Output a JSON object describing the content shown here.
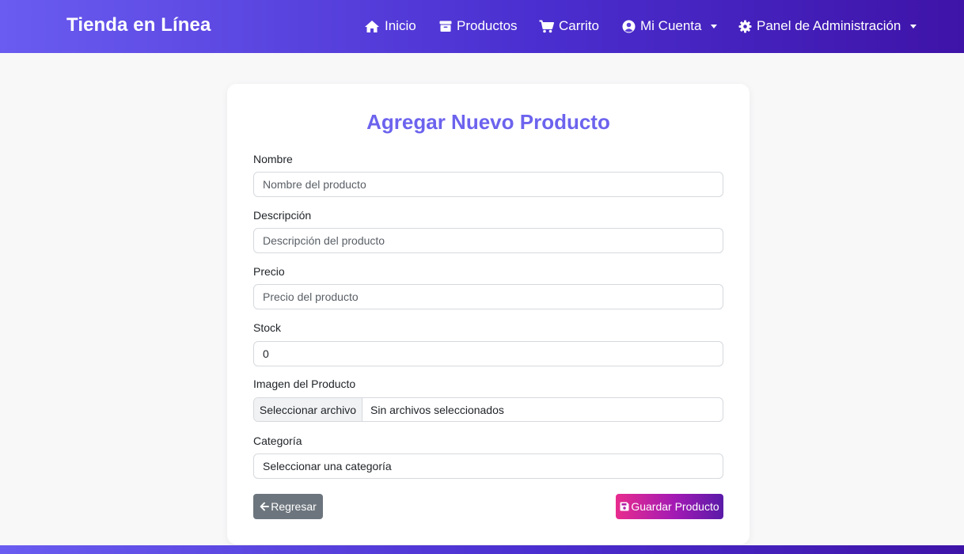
{
  "navbar": {
    "brand": "Tienda en Línea",
    "items": [
      {
        "label": "Inicio",
        "icon": "home-icon"
      },
      {
        "label": "Productos",
        "icon": "box-icon"
      },
      {
        "label": "Carrito",
        "icon": "cart-icon"
      },
      {
        "label": "Mi Cuenta",
        "icon": "user-circle-icon",
        "dropdown": true
      },
      {
        "label": "Panel de Administración",
        "icon": "gear-icon",
        "dropdown": true
      }
    ]
  },
  "form": {
    "title": "Agregar Nuevo Producto",
    "fields": {
      "nombre": {
        "label": "Nombre",
        "placeholder": "Nombre del producto",
        "value": ""
      },
      "descripcion": {
        "label": "Descripción",
        "placeholder": "Descripción del producto",
        "value": ""
      },
      "precio": {
        "label": "Precio",
        "placeholder": "Precio del producto",
        "value": ""
      },
      "stock": {
        "label": "Stock",
        "placeholder": "",
        "value": "0"
      },
      "imagen": {
        "label": "Imagen del Producto",
        "button_label": "Seleccionar archivo",
        "status": "Sin archivos seleccionados"
      },
      "categoria": {
        "label": "Categoría",
        "selected": "Seleccionar una categoría"
      }
    },
    "buttons": {
      "back": {
        "label": "Regresar",
        "icon": "arrow-left-icon"
      },
      "save": {
        "label": "Guardar Producto",
        "icon": "floppy-disk-icon"
      }
    }
  },
  "colors": {
    "accent": "#6c63ee",
    "nav_gradient_start": "#6a5cf0",
    "nav_gradient_end": "#3e13a8",
    "back_button": "#6c757d",
    "save_gradient_start": "#e82c8e",
    "save_gradient_end": "#5a1aa8"
  }
}
